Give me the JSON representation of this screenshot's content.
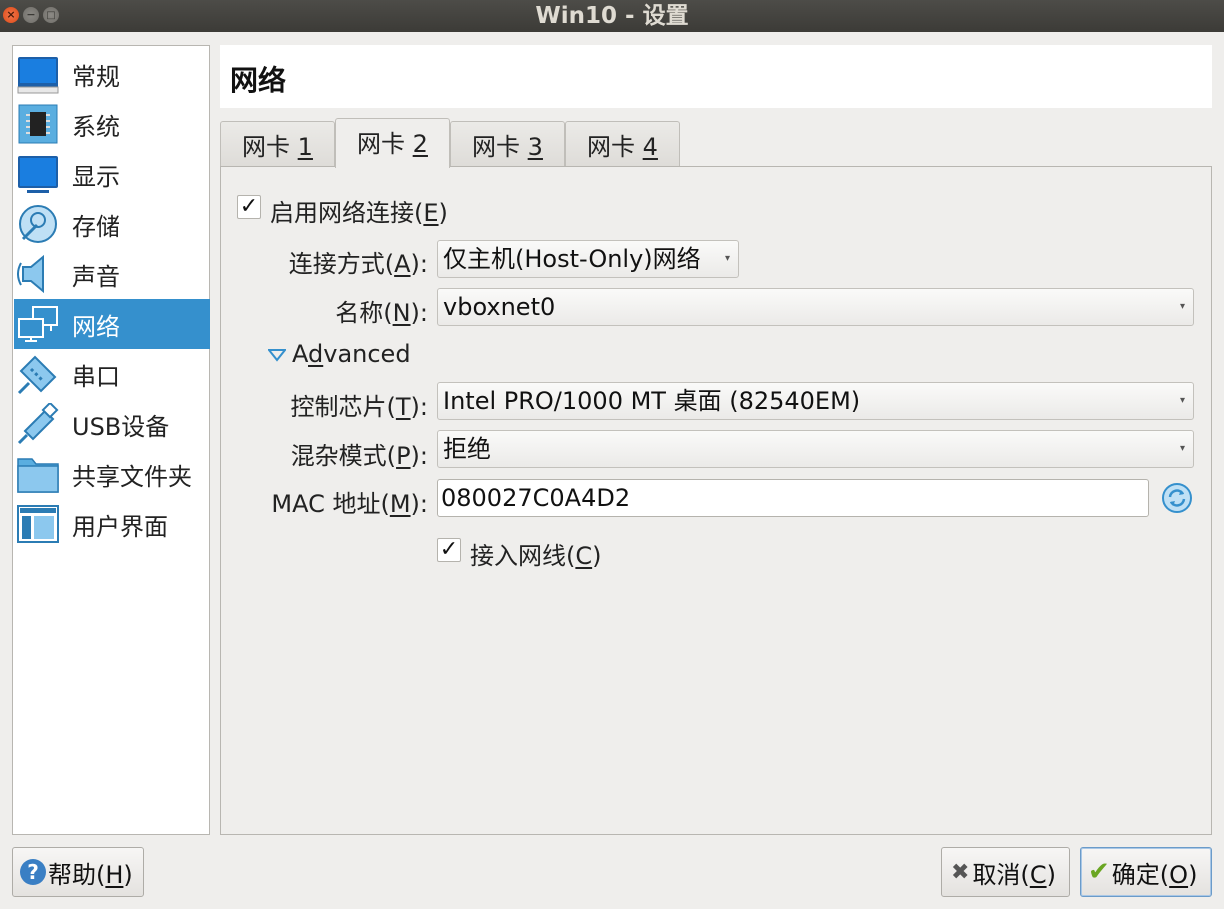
{
  "window": {
    "title": "Win10 - 设置",
    "close_glyph": "×",
    "min_glyph": "−",
    "max_glyph": "□"
  },
  "sidebar": {
    "items": [
      {
        "label": "常规",
        "icon": "general-icon"
      },
      {
        "label": "系统",
        "icon": "chip-icon"
      },
      {
        "label": "显示",
        "icon": "monitor-icon"
      },
      {
        "label": "存储",
        "icon": "disk-icon"
      },
      {
        "label": "声音",
        "icon": "speaker-icon"
      },
      {
        "label": "网络",
        "icon": "network-icon",
        "active": true
      },
      {
        "label": "串口",
        "icon": "serial-icon"
      },
      {
        "label": "USB设备",
        "icon": "usb-icon"
      },
      {
        "label": "共享文件夹",
        "icon": "folder-icon"
      },
      {
        "label": "用户界面",
        "icon": "ui-icon"
      }
    ]
  },
  "page": {
    "title": "网络"
  },
  "tabs": [
    {
      "prefix": "网卡 ",
      "mnemonic": "1"
    },
    {
      "prefix": "网卡 ",
      "mnemonic": "2",
      "active": true
    },
    {
      "prefix": "网卡 ",
      "mnemonic": "3"
    },
    {
      "prefix": "网卡 ",
      "mnemonic": "4"
    }
  ],
  "form": {
    "enable": {
      "checked_glyph": "✓",
      "prefix": "启用网络连接(",
      "mnemonic": "E",
      "suffix": ")"
    },
    "attach": {
      "prefix": "连接方式(",
      "mnemonic": "A",
      "suffix": "):",
      "value": "仅主机(Host-Only)网络"
    },
    "name": {
      "prefix": "名称(",
      "mnemonic": "N",
      "suffix": "):",
      "value": "vboxnet0"
    },
    "advanced": {
      "label_a": "A",
      "mnemonic": "d",
      "label_b": "vanced"
    },
    "adapter": {
      "prefix": "控制芯片(",
      "mnemonic": "T",
      "suffix": "):",
      "value": "Intel PRO/1000 MT 桌面 (82540EM)"
    },
    "promisc": {
      "prefix": "混杂模式(",
      "mnemonic": "P",
      "suffix": "):",
      "value": "拒绝"
    },
    "mac": {
      "prefix": "MAC 地址(",
      "mnemonic": "M",
      "suffix": "):",
      "value": "080027C0A4D2"
    },
    "cable": {
      "checked_glyph": "✓",
      "prefix": "接入网线(",
      "mnemonic": "C",
      "suffix": ")"
    },
    "dropdown_glyph": "▾"
  },
  "footer": {
    "help": {
      "prefix": "帮助(",
      "mnemonic": "H",
      "suffix": ")",
      "icon_glyph": "?"
    },
    "cancel": {
      "prefix": "取消(",
      "mnemonic": "C",
      "suffix": ")",
      "icon_glyph": "✖"
    },
    "ok": {
      "prefix": "确定(",
      "mnemonic": "O",
      "suffix": ")",
      "icon_glyph": "✔"
    }
  },
  "colors": {
    "accent": "#3590cd",
    "titlebar": "#3c3b37",
    "window_bg": "#efeeec"
  }
}
